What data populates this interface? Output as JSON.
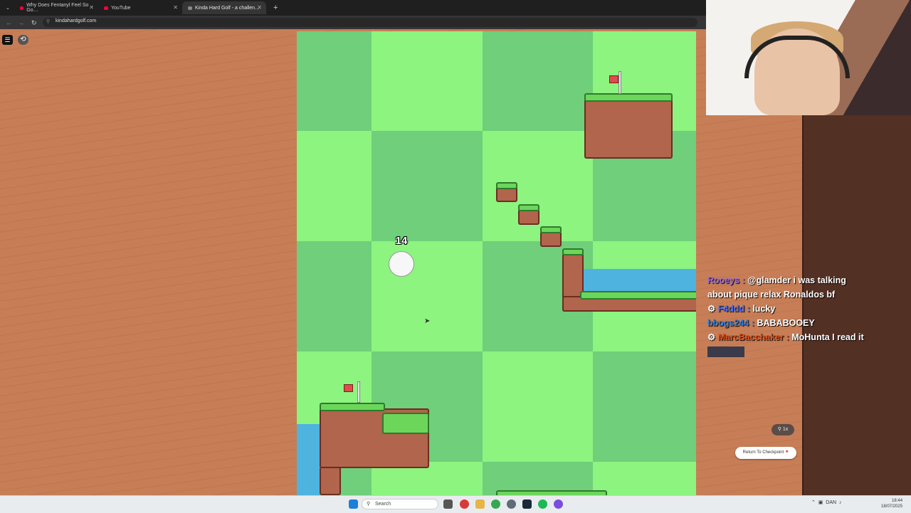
{
  "browser": {
    "tabs": [
      {
        "title": "Why Does Fentanyl Feel So Go…",
        "favicon_color": "#ff0033"
      },
      {
        "title": "YouTube",
        "favicon_color": "#ff0033"
      },
      {
        "title": "Kinda Hard Golf - a challen…",
        "favicon_color": "#888888"
      }
    ],
    "new_tab": "+",
    "url": "kindahardgolf.com"
  },
  "game": {
    "stroke_count": "14",
    "menu_icon": "☰",
    "reset_icon": "⟲",
    "zoom_label": "1x",
    "checkpoint_label": "Return To Checkpoint",
    "colors": {
      "tile_light": "#8cf47f",
      "tile_dark": "#6fcf7a",
      "dirt": "#b1654c",
      "water": "#4fb3e0",
      "flag": "#e04b4b"
    }
  },
  "chat": {
    "messages": [
      {
        "user": "Rooeys",
        "color": "#9b6bd6",
        "text": "@glamder i was talking about pique relax Ronaldos bf"
      },
      {
        "user": "F4ddd",
        "color": "#4a6cf0",
        "text": "lucky"
      },
      {
        "user": "bbogs244",
        "color": "#2f7fe0",
        "text": "BABABOOEY"
      },
      {
        "user": "MarcBacchaker",
        "color": "#e0501f",
        "text": "MoHunta I read it"
      }
    ]
  },
  "taskbar": {
    "search_placeholder": "Search",
    "language": "DAN",
    "time": "18:44",
    "date": "18/07/2025"
  }
}
